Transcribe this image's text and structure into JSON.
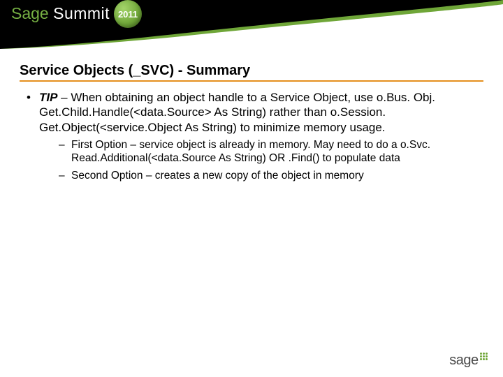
{
  "header": {
    "brand_first": "Sage",
    "brand_second": "Summit",
    "year_badge": "2011"
  },
  "slide": {
    "title": "Service Objects (_SVC) - Summary",
    "bullet1": {
      "tip_label": "TIP",
      "text": " – When obtaining an object handle to a Service Object, use o.Bus. Obj. Get.Child.Handle(<data.Source> As String) rather than o.Session. Get.Object(<service.Object As String) to minimize memory usage."
    },
    "sub1": "First Option – service object is already in memory. May need to do a o.Svc. Read.Additional(<data.Source As String) OR .Find() to populate data",
    "sub2": "Second Option – creates a new copy of the object in memory"
  },
  "footer": {
    "brand": "sage"
  }
}
